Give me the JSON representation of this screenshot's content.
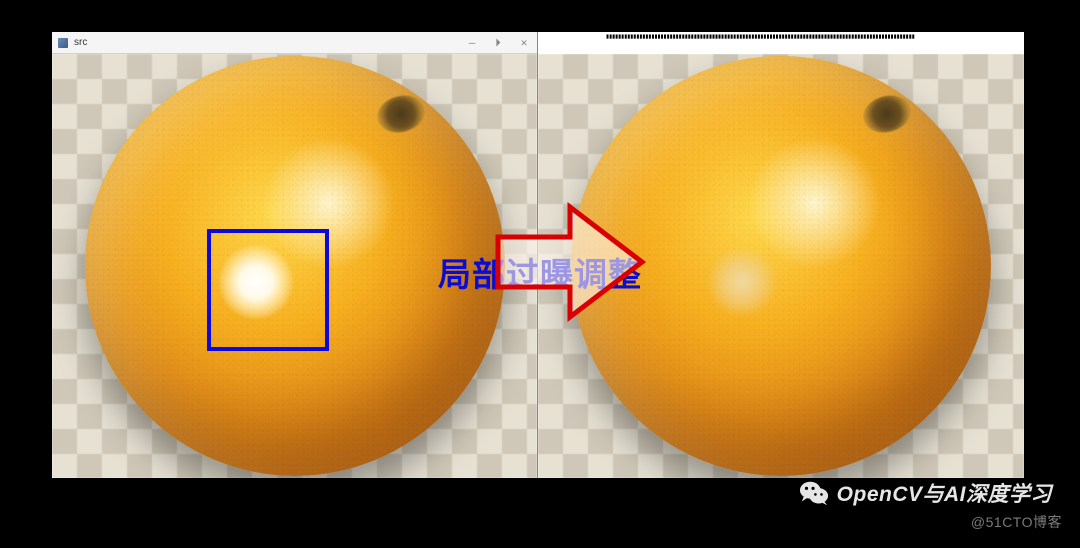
{
  "left_window": {
    "title": "src",
    "controls": {
      "minimize": "—",
      "restore": "⏵",
      "close": "✕"
    }
  },
  "annotation": {
    "center_label": "局部过曝调整"
  },
  "watermark": {
    "text": "OpenCV与AI深度学习"
  },
  "credit": "@51CTO博客"
}
